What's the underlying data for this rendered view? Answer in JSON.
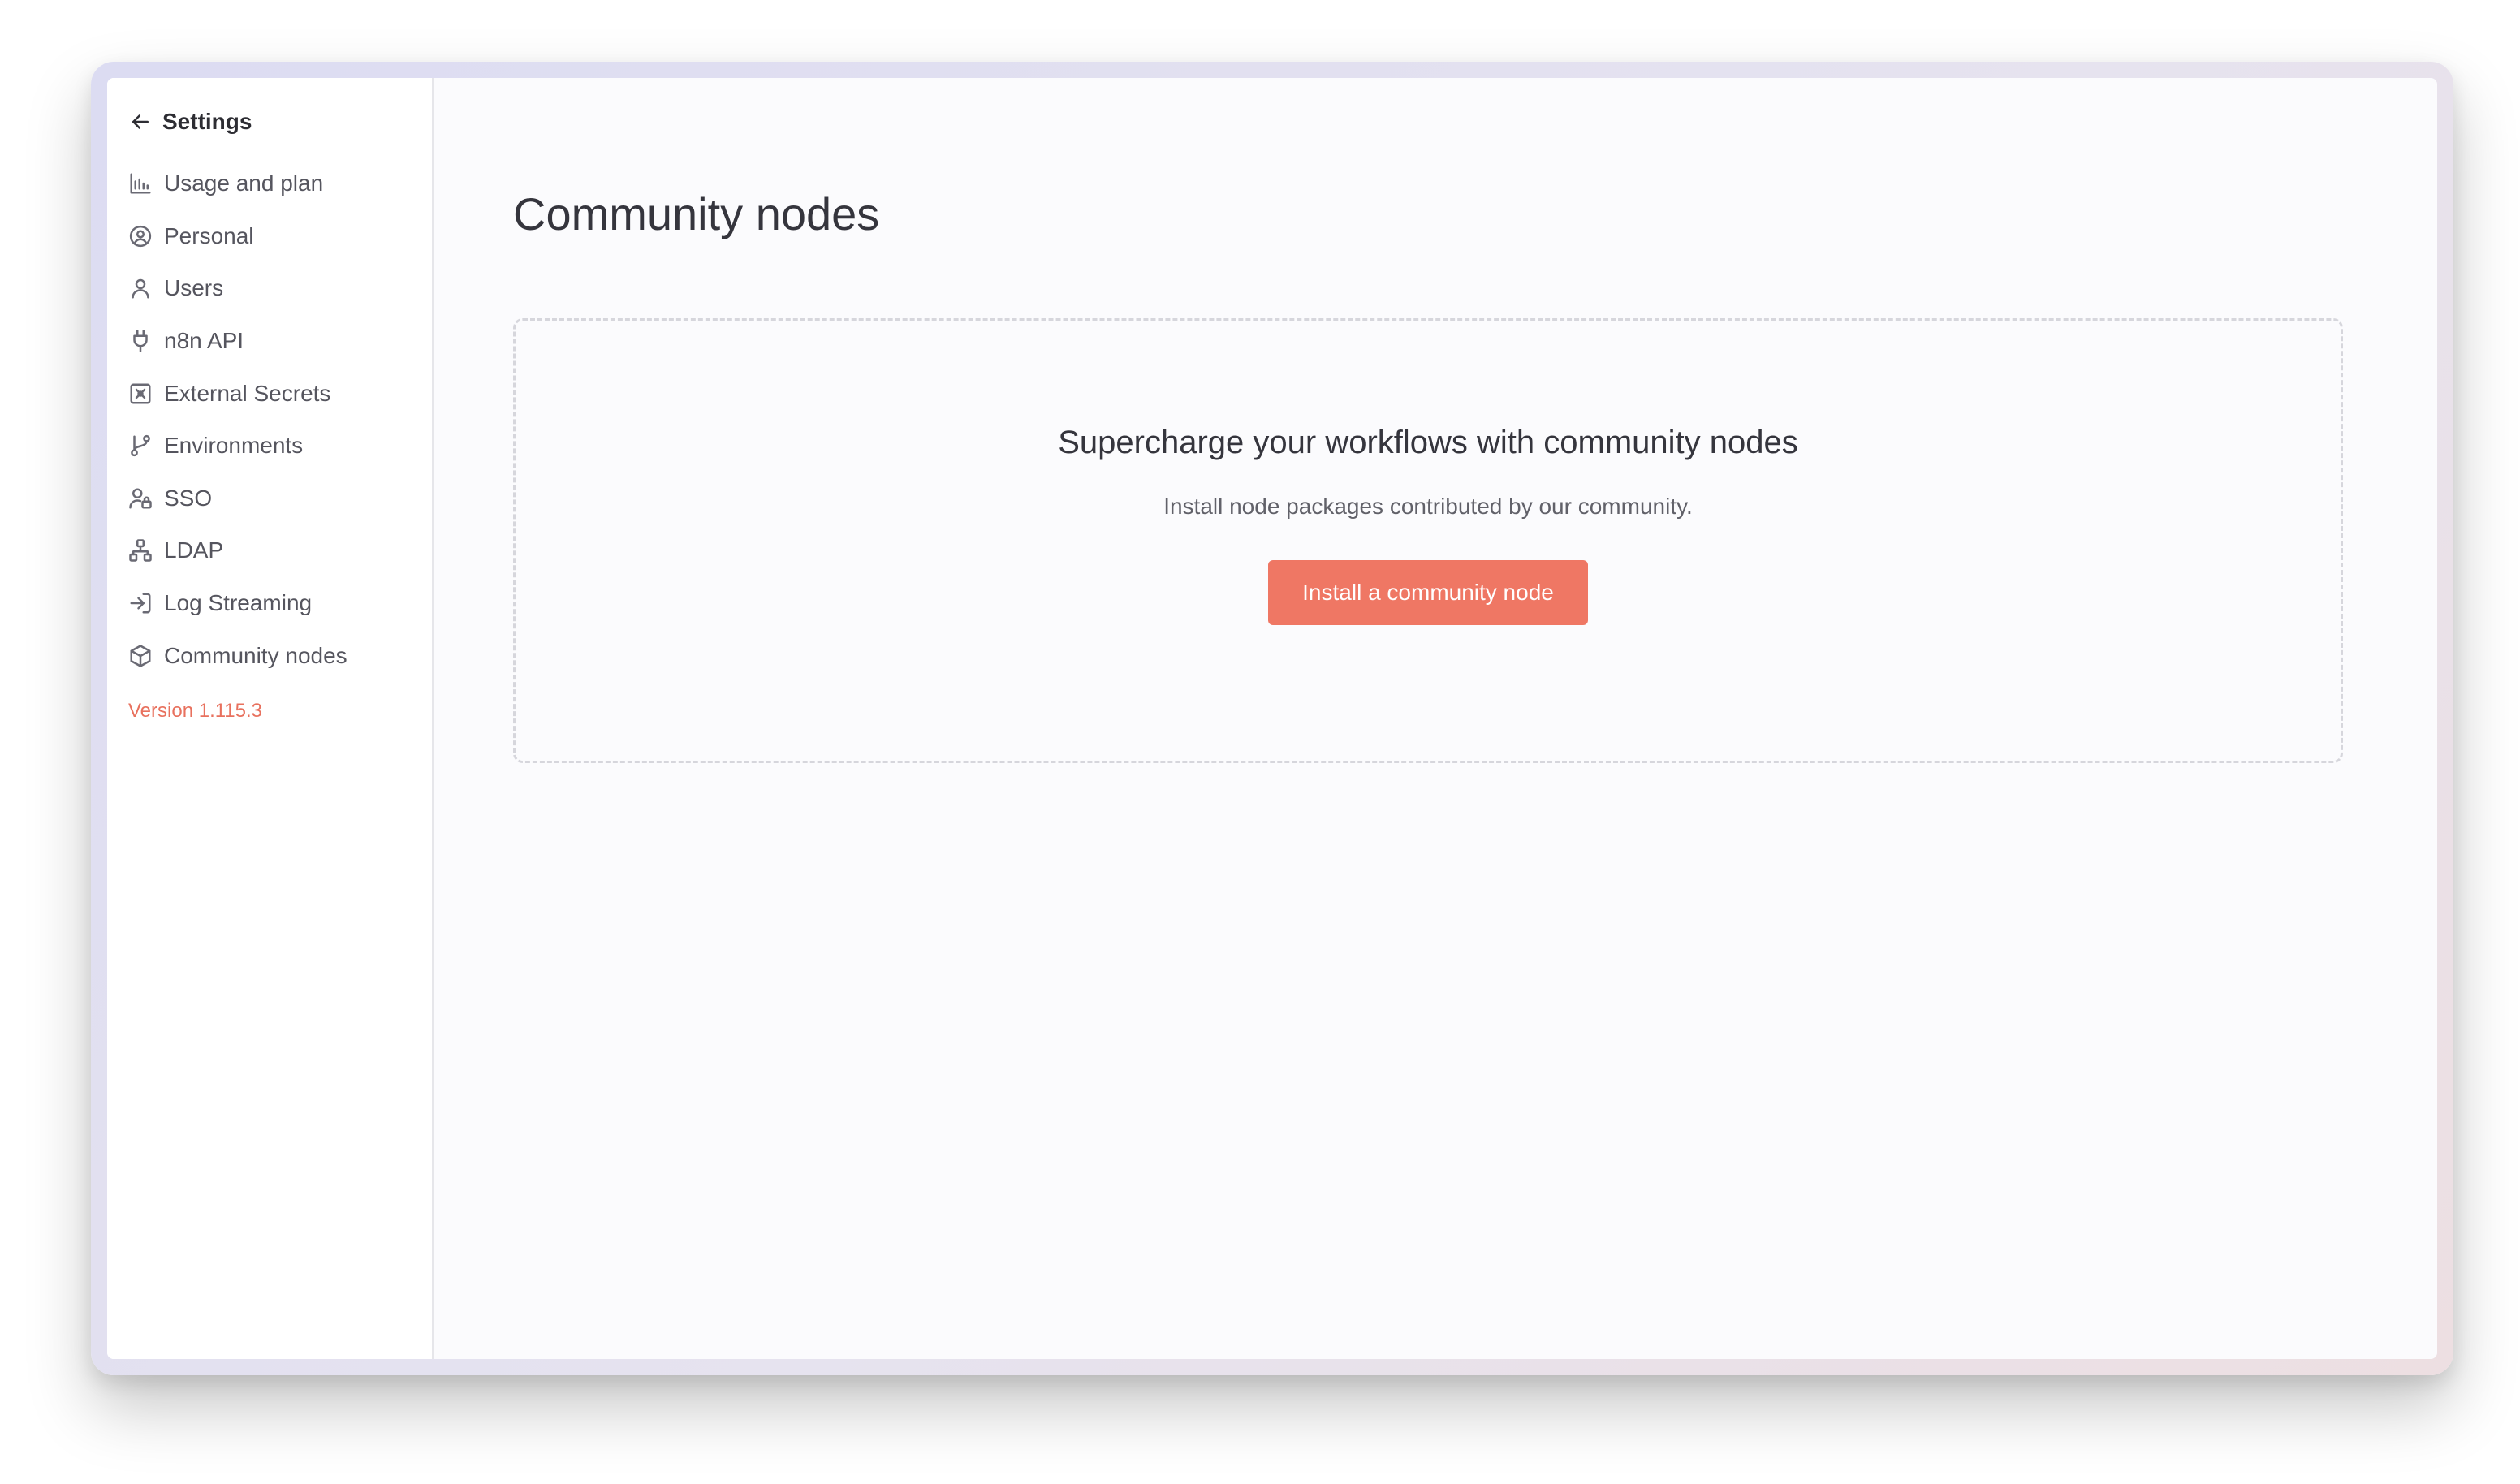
{
  "sidebar": {
    "back_label": "Settings",
    "items": [
      {
        "label": "Usage and plan",
        "icon": "bar-chart-icon"
      },
      {
        "label": "Personal",
        "icon": "user-circle-icon"
      },
      {
        "label": "Users",
        "icon": "user-icon"
      },
      {
        "label": "n8n API",
        "icon": "plug-icon"
      },
      {
        "label": "External Secrets",
        "icon": "vault-icon"
      },
      {
        "label": "Environments",
        "icon": "git-branch-icon"
      },
      {
        "label": "SSO",
        "icon": "user-lock-icon"
      },
      {
        "label": "LDAP",
        "icon": "network-icon"
      },
      {
        "label": "Log Streaming",
        "icon": "sign-in-icon"
      },
      {
        "label": "Community nodes",
        "icon": "cube-icon"
      }
    ],
    "version": "Version 1.115.3"
  },
  "main": {
    "title": "Community nodes",
    "empty_state": {
      "heading": "Supercharge your workflows with community nodes",
      "description": "Install node packages contributed by our community.",
      "button_label": "Install a community node"
    }
  },
  "colors": {
    "accent": "#ef7764",
    "version_text": "#e8715e",
    "sidebar_bg": "#ffffff",
    "main_bg": "#fbfbfd"
  }
}
